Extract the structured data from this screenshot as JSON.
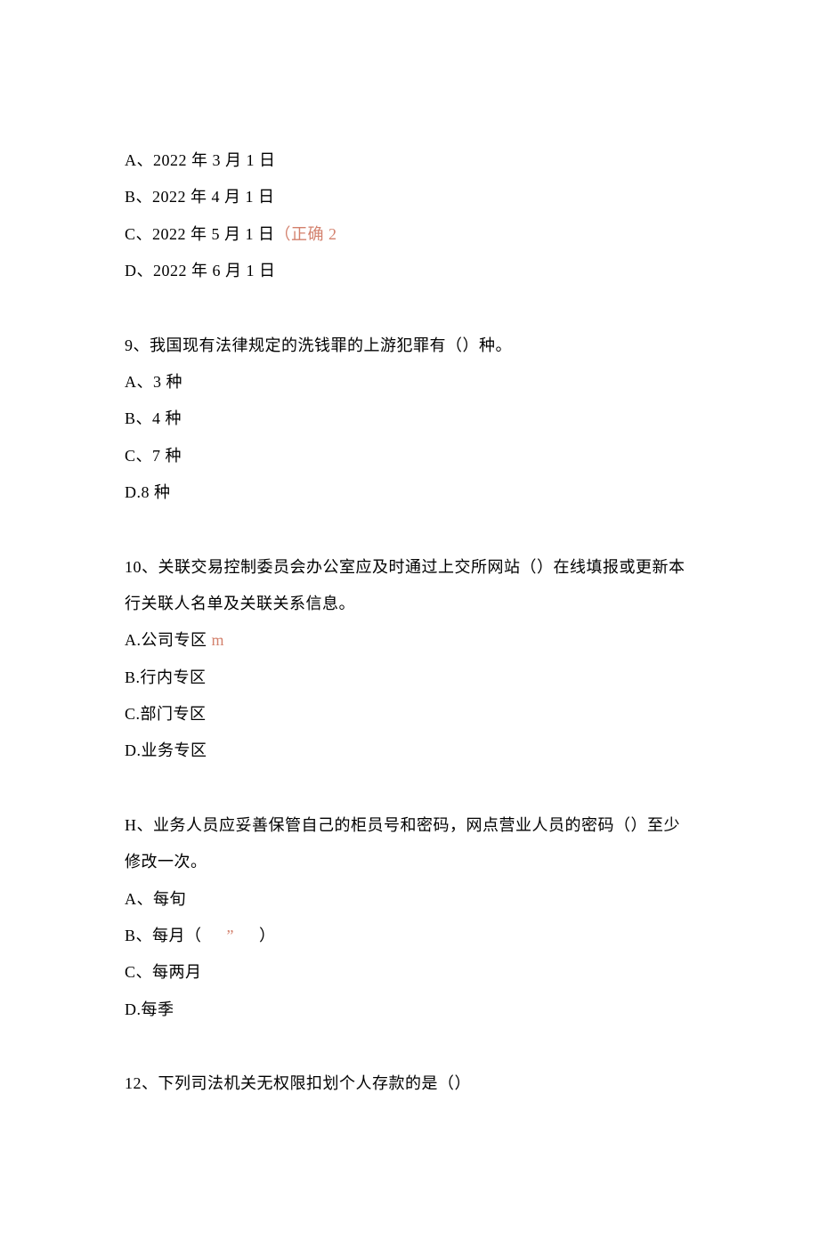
{
  "q8_options": {
    "a": "A、2022 年 3 月 1 日",
    "b": "B、2022 年 4 月 1 日",
    "c_prefix": "C、2022 年 5 月 1 日",
    "c_note": "（正确 2",
    "d": "D、2022 年 6 月 1 日"
  },
  "q9": {
    "prompt": "9、我国现有法律规定的洗钱罪的上游犯罪有（）种。",
    "a": "A、3 种",
    "b": "B、4 种",
    "c": "C、7 种",
    "d": "D.8 种"
  },
  "q10": {
    "prompt": "10、关联交易控制委员会办公室应及时通过上交所网站（）在线填报或更新本行关联人名单及关联关系信息。",
    "a_prefix": "A.公司专区",
    "a_note": " m",
    "b": "B.行内专区",
    "c": "C.部门专区",
    "d": "D.业务专区"
  },
  "q11": {
    "prompt": "H、业务人员应妥善保管自己的柜员号和密码，网点营业人员的密码（）至少修改一次。",
    "a": "A、每旬",
    "b_prefix": "B、每月（",
    "b_note": "”",
    "b_suffix": "）",
    "c": "C、每两月",
    "d": "D.每季"
  },
  "q12": {
    "prompt": "12、下列司法机关无权限扣划个人存款的是（）"
  }
}
